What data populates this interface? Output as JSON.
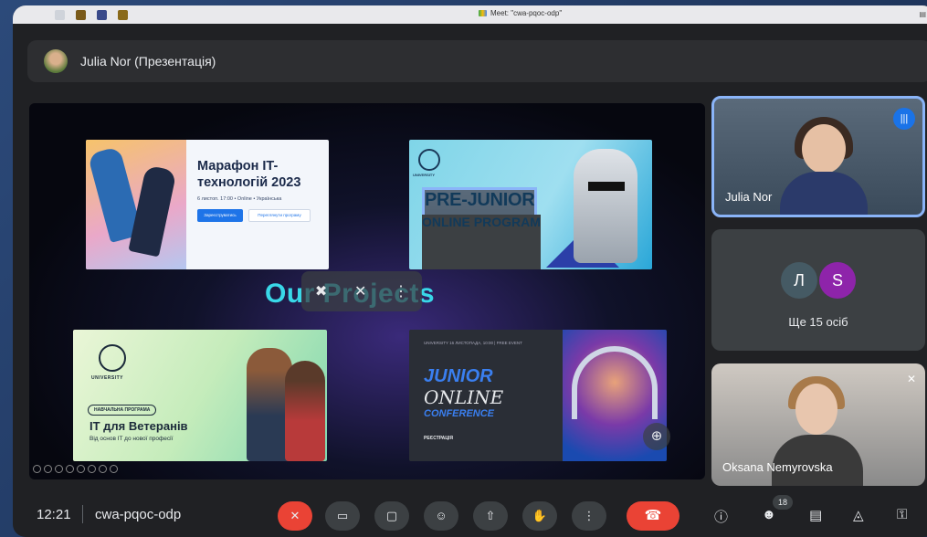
{
  "window": {
    "title": "Meet: \"cwa-pqoc-odp\""
  },
  "presenter": {
    "label": "Julia Nor (Презентація)"
  },
  "slide": {
    "heading": "Our Projects",
    "cards": {
      "marathon": {
        "title_line1": "Марафон IT-",
        "title_line2": "технологій 2023",
        "details": "6 листоп. 17:00 • Online • Українська",
        "btn_primary": "Зареєструватись",
        "btn_secondary": "Переглянути програму"
      },
      "prejunior": {
        "logo": "UNIVERSITY",
        "line1": "PRE-JUNIOR",
        "line2": "ONLINE PROGRAM"
      },
      "veterans": {
        "logo": "UNIVERSITY",
        "pill": "НАВЧАЛЬНА ПРОГРАМА",
        "title": "IT для Ветеранів",
        "subtitle": "Від основ IT до нової професії"
      },
      "junior": {
        "top": "UNIVERSITY   16 ЛИСТОПАДА, 10:00 | FREE EVENT",
        "line1": "JUNIOR",
        "line2": "ONLINE",
        "line3": "CONFERENCE",
        "register": "РЕЄСТРАЦІЯ"
      }
    }
  },
  "participants": {
    "julia": {
      "name": "Julia Nor"
    },
    "others": {
      "initial1": "Л",
      "initial2": "S",
      "more": "Ще 15 осіб"
    },
    "oksana": {
      "name": "Oksana Nemyrovska"
    }
  },
  "toolbar": {
    "time": "12:21",
    "meeting_code": "cwa-pqoc-odp",
    "people_count": "18"
  },
  "colors": {
    "accent": "#8ab4f8",
    "danger": "#ea4335",
    "surface": "#3c4043",
    "background": "#202124"
  }
}
